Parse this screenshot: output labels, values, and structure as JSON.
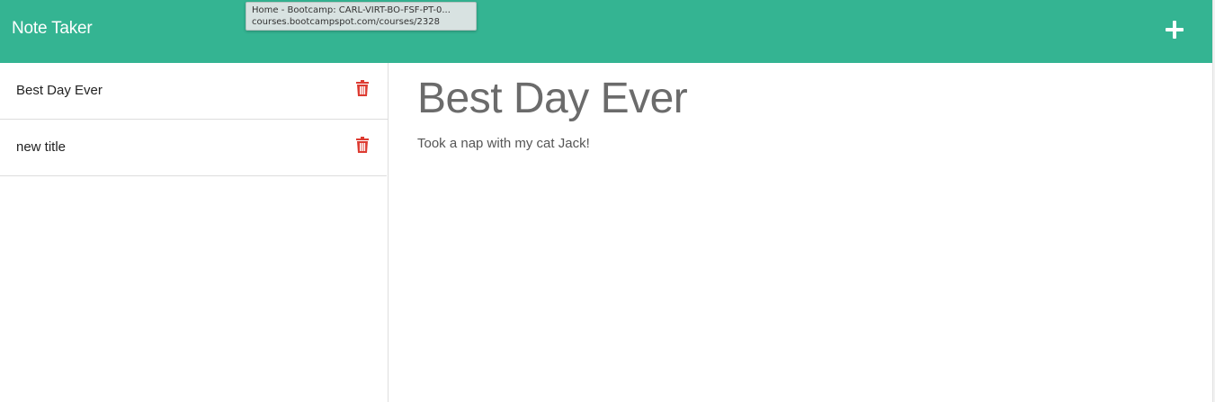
{
  "navbar": {
    "brand": "Note Taker",
    "new_note_icon": "plus-icon",
    "background": "#34b492"
  },
  "tooltip": {
    "line1": "Home - Bootcamp: CARL-VIRT-BO-FSF-PT-0...",
    "line2": "courses.bootcampspot.com/courses/2328"
  },
  "sidebar": {
    "notes": [
      {
        "title": "Best Day Ever",
        "delete_icon": "trash-icon"
      },
      {
        "title": "new title",
        "delete_icon": "trash-icon"
      }
    ],
    "delete_color": "#dd3b31"
  },
  "main": {
    "note_title": "Best Day Ever",
    "note_text": "Took a nap with my cat Jack!"
  }
}
